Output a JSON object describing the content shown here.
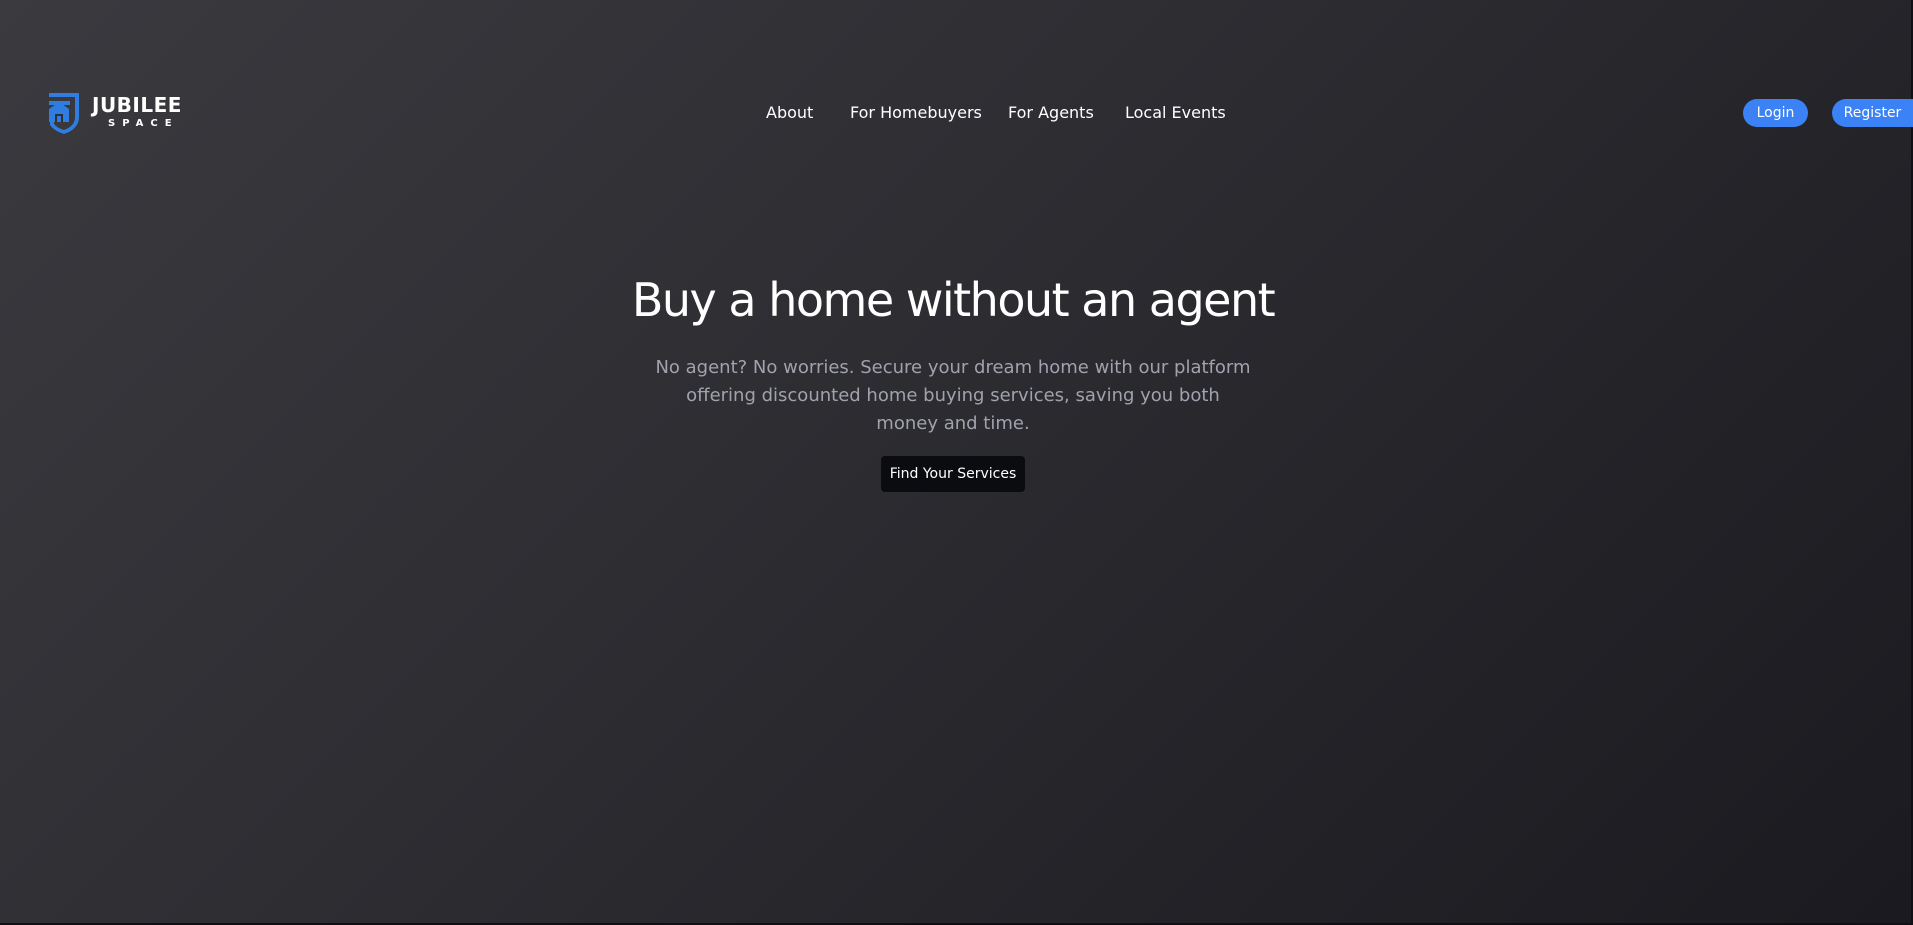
{
  "header": {
    "logo": {
      "wordmark": "JUBILEE",
      "subtitle": "SPACE",
      "icon": "house-shield-icon",
      "color": "#2f7de1"
    },
    "nav": [
      {
        "label": "About"
      },
      {
        "label": "For Homebuyers"
      },
      {
        "label": "For Agents"
      },
      {
        "label": "Local Events"
      }
    ],
    "login_label": "Login",
    "register_label": "Register"
  },
  "hero": {
    "title": "Buy a home without an agent",
    "description": "No agent? No worries. Secure your dream home with our platform offering discounted home buying services, saving you both money and time.",
    "cta_label": "Find Your Services"
  },
  "colors": {
    "accent": "#3b82f6",
    "background_dark": "#2a2a2f",
    "cta_background": "#0b0c10",
    "description_text": "#a0a3ad"
  }
}
